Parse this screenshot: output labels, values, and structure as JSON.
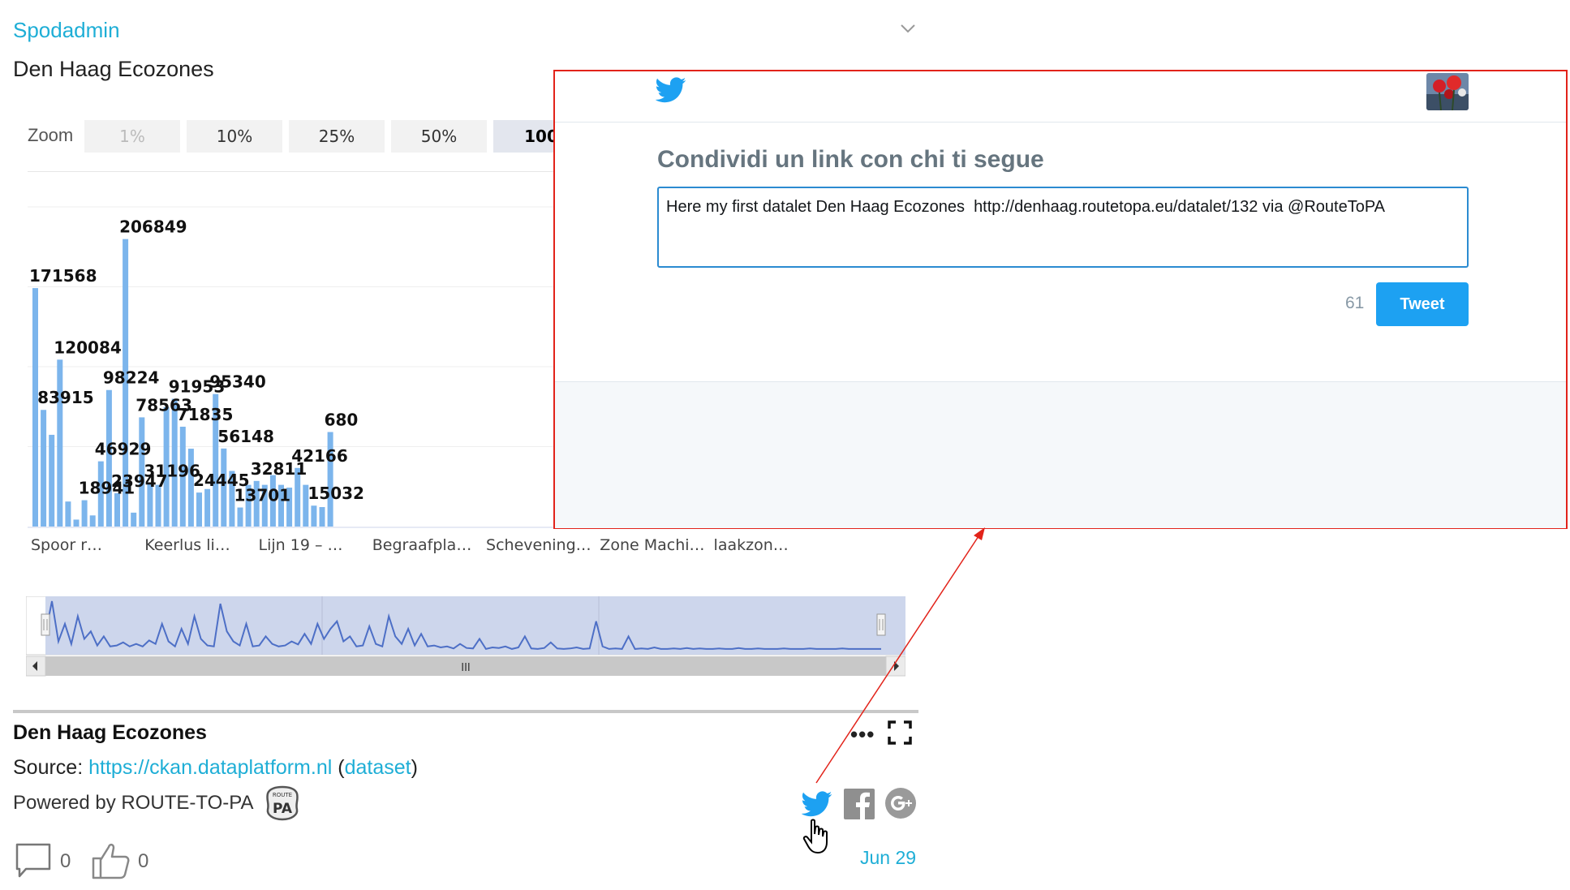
{
  "header": {
    "author": "Spodadmin",
    "title": "Den Haag Ecozones",
    "collapse_icon": "chevron-down-icon"
  },
  "zoom": {
    "label": "Zoom",
    "options": [
      "1%",
      "10%",
      "25%",
      "50%",
      "100"
    ],
    "disabled": "1%",
    "selected": "100"
  },
  "chart_data": {
    "type": "bar",
    "title": "",
    "xlabel": "",
    "ylabel": "",
    "ylim": [
      0,
      230000
    ],
    "color": "#7cb5ec",
    "values": [
      171568,
      83915,
      66000,
      120084,
      18000,
      5000,
      18941,
      8000,
      46929,
      98224,
      23947,
      206849,
      10000,
      78563,
      31196,
      30000,
      86000,
      91953,
      71835,
      56000,
      24445,
      27000,
      95340,
      56148,
      40000,
      13701,
      30000,
      32811,
      30000,
      37000,
      30000,
      28000,
      42166,
      30000,
      15032,
      14000,
      68000
    ],
    "data_labels": [
      {
        "i": 0,
        "text": "171568"
      },
      {
        "i": 1,
        "text": "83915"
      },
      {
        "i": 3,
        "text": "120084"
      },
      {
        "i": 6,
        "text": "18941"
      },
      {
        "i": 8,
        "text": "46929"
      },
      {
        "i": 9,
        "text": "98224"
      },
      {
        "i": 10,
        "text": "23947"
      },
      {
        "i": 11,
        "text": "206849"
      },
      {
        "i": 13,
        "text": "78563"
      },
      {
        "i": 14,
        "text": "31196"
      },
      {
        "i": 17,
        "text": "91953"
      },
      {
        "i": 18,
        "text": "71835"
      },
      {
        "i": 20,
        "text": "24445"
      },
      {
        "i": 22,
        "text": "95340"
      },
      {
        "i": 23,
        "text": "56148"
      },
      {
        "i": 25,
        "text": "13701"
      },
      {
        "i": 27,
        "text": "32811"
      },
      {
        "i": 32,
        "text": "42166"
      },
      {
        "i": 34,
        "text": "15032"
      },
      {
        "i": 36,
        "text": "680"
      }
    ],
    "category_labels": [
      "Spoor r…",
      "Keerlus li…",
      "Lijn 19 – …",
      "Begraafpla…",
      "Schevening…",
      "Zone Machi…",
      "laakzon…"
    ]
  },
  "navigator": {
    "series": [
      0.35,
      1.0,
      0.2,
      0.55,
      0.15,
      0.7,
      0.25,
      0.4,
      0.12,
      0.3,
      0.1,
      0.12,
      0.18,
      0.1,
      0.15,
      0.1,
      0.22,
      0.15,
      0.55,
      0.2,
      0.1,
      0.45,
      0.15,
      0.7,
      0.25,
      0.12,
      0.1,
      0.95,
      0.4,
      0.2,
      0.12,
      0.55,
      0.1,
      0.12,
      0.3,
      0.15,
      0.1,
      0.12,
      0.2,
      0.14,
      0.35,
      0.15,
      0.55,
      0.25,
      0.45,
      0.6,
      0.2,
      0.3,
      0.1,
      0.12,
      0.5,
      0.15,
      0.1,
      0.7,
      0.3,
      0.15,
      0.45,
      0.12,
      0.35,
      0.1,
      0.12,
      0.08,
      0.1,
      0.06,
      0.15,
      0.07,
      0.06,
      0.25,
      0.05,
      0.08,
      0.07,
      0.1,
      0.05,
      0.08,
      0.3,
      0.06,
      0.05,
      0.07,
      0.18,
      0.06,
      0.05,
      0.06,
      0.08,
      0.05,
      0.06,
      0.6,
      0.1,
      0.05,
      0.06,
      0.05,
      0.3,
      0.05,
      0.06,
      0.05,
      0.08,
      0.05,
      0.05,
      0.06,
      0.05,
      0.07,
      0.05,
      0.06,
      0.05,
      0.05,
      0.06,
      0.05,
      0.05,
      0.07,
      0.05,
      0.05,
      0.06,
      0.05,
      0.05,
      0.05,
      0.06,
      0.05,
      0.05,
      0.05,
      0.06,
      0.05,
      0.05,
      0.05,
      0.05,
      0.06,
      0.05,
      0.05,
      0.05,
      0.05,
      0.05,
      0.05
    ],
    "scrollbar_grip": "III"
  },
  "info": {
    "title": "Den Haag Ecozones",
    "more_label": "•••",
    "source_label": "Source:",
    "source_url": "https://ckan.dataplatform.nl",
    "dataset_open": "(",
    "dataset_link": "dataset",
    "dataset_close": ")",
    "powered_by": "Powered by ROUTE-TO-PA",
    "logo_top": "ROUTE",
    "logo_main": "PA",
    "comments": "0",
    "likes": "0",
    "date": "Jun 29",
    "icons": [
      "twitter-icon",
      "facebook-icon",
      "google-plus-icon",
      "comment-icon",
      "thumbs-up-icon",
      "fullscreen-icon",
      "hand-cursor-icon"
    ]
  },
  "twitter_share": {
    "heading": "Condividi un link con chi ti segue",
    "text": "Here my first datalet Den Haag Ecozones  http://denhaag.routetopa.eu/datalet/132 via @RouteToPA",
    "char_count": "61",
    "tweet_label": "Tweet",
    "brand_color": "#1da1f2",
    "highlight_color": "#e2231a"
  }
}
